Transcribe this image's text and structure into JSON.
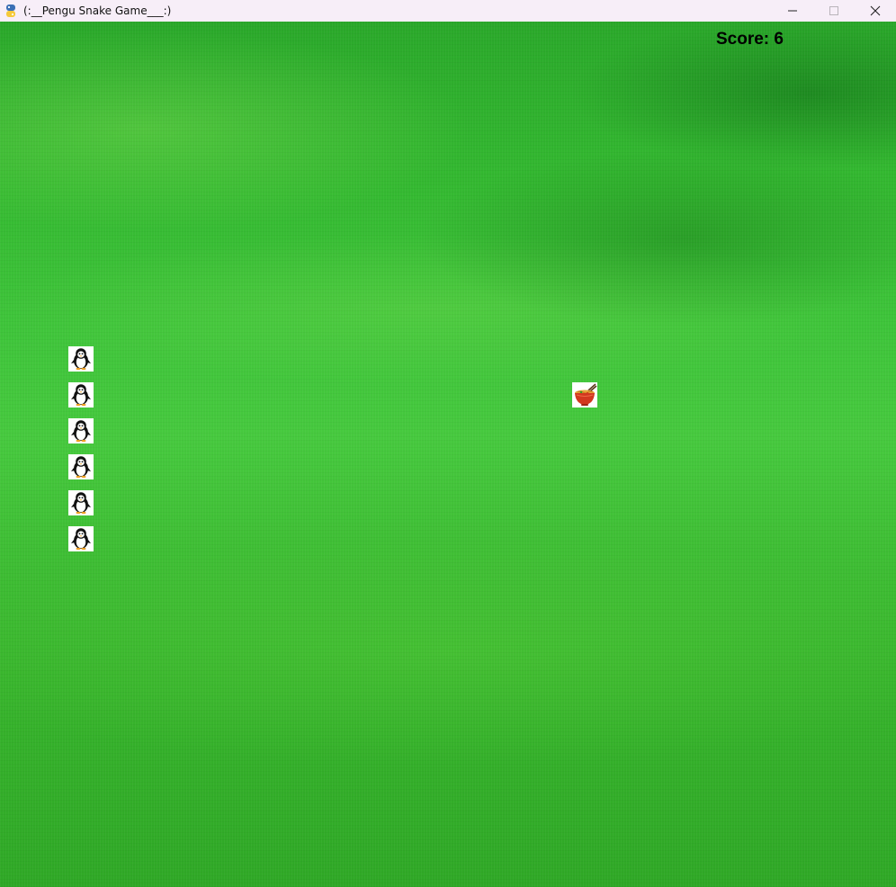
{
  "window": {
    "title": "(:__Pengu Snake Game___:)",
    "app_icon": "python-icon",
    "controls": [
      "minimize-icon",
      "maximize-icon",
      "close-icon"
    ]
  },
  "game": {
    "score_text": "Score: 6",
    "background": "grass-field",
    "snake_segment_icon": "penguin-icon",
    "food_icon": "noodle-bowl-icon",
    "snake_length": 6
  }
}
